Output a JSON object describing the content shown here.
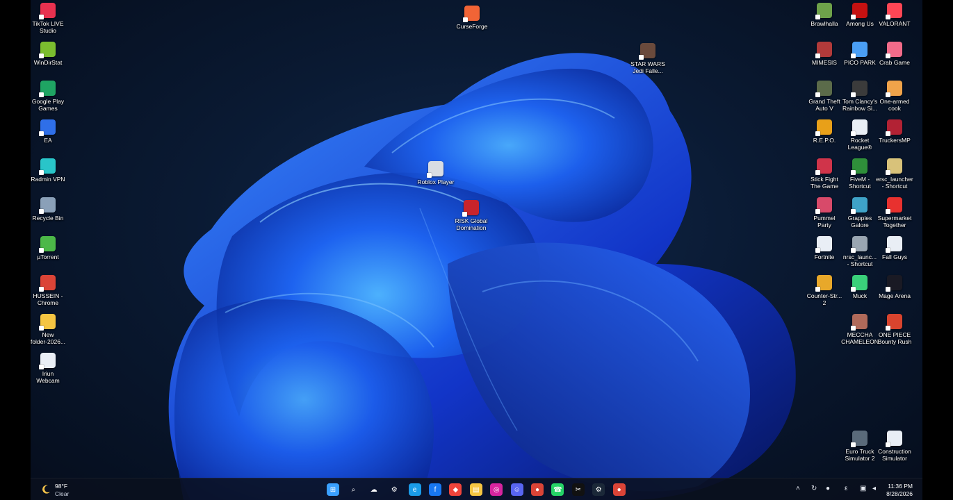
{
  "desktop": {
    "left_column": [
      {
        "name": "TikTok LIVE\nStudio",
        "icon": "tiktok-live-studio-icon",
        "color": "#e8314f"
      },
      {
        "name": "WinDirStat",
        "icon": "windirstat-icon",
        "color": "#7bbd2f"
      },
      {
        "name": "Google Play\nGames",
        "icon": "google-play-games-icon",
        "color": "#1fa463"
      },
      {
        "name": "EA",
        "icon": "ea-icon",
        "color": "#2f6fe8"
      },
      {
        "name": "Radmin VPN",
        "icon": "radmin-vpn-icon",
        "color": "#29c5c9"
      },
      {
        "name": "Recycle Bin",
        "icon": "recycle-bin-icon",
        "color": "#8aa0b8"
      },
      {
        "name": "µTorrent",
        "icon": "utorrent-icon",
        "color": "#4cb848"
      },
      {
        "name": "HUSSEIN -\nChrome",
        "icon": "chrome-icon",
        "color": "#db4437"
      },
      {
        "name": "New\nfolder-2026...",
        "icon": "folder-icon",
        "color": "#f5c542"
      },
      {
        "name": "Iriun\nWebcam",
        "icon": "iriun-webcam-icon",
        "color": "#e9eef5"
      }
    ],
    "top_center": [
      {
        "name": "CurseForge",
        "icon": "curseforge-icon",
        "color": "#f16436"
      },
      {
        "name": "STAR WARS\nJedi Falle...",
        "icon": "star-wars-jedi-icon",
        "color": "#6a4a3c"
      },
      {
        "name": "Roblox Player",
        "icon": "roblox-icon",
        "color": "#d9dde3"
      },
      {
        "name": "RISK Global\nDomination",
        "icon": "risk-icon",
        "color": "#c8242b"
      }
    ],
    "right_grid": [
      {
        "name": "Brawlhalla",
        "icon": "brawlhalla-icon",
        "color": "#6ea24a"
      },
      {
        "name": "Among Us",
        "icon": "among-us-icon",
        "color": "#c51111"
      },
      {
        "name": "VALORANT",
        "icon": "valorant-icon",
        "color": "#ff4655"
      },
      {
        "name": "MIMESIS",
        "icon": "mimesis-icon",
        "color": "#b23a3a"
      },
      {
        "name": "PICO PARK",
        "icon": "pico-park-icon",
        "color": "#4a9ff5"
      },
      {
        "name": "Crab Game",
        "icon": "crab-game-icon",
        "color": "#f26b8a"
      },
      {
        "name": "Grand Theft\nAuto V",
        "icon": "gta-v-icon",
        "color": "#5b6b4a"
      },
      {
        "name": "Tom Clancy's\nRainbow Si...",
        "icon": "rainbow-six-icon",
        "color": "#3b3b3b"
      },
      {
        "name": "One-armed\ncook",
        "icon": "one-armed-cook-icon",
        "color": "#f0a34a"
      },
      {
        "name": "R.E.P.O.",
        "icon": "repo-icon",
        "color": "#e8a019"
      },
      {
        "name": "Rocket\nLeague®",
        "icon": "rocket-league-icon",
        "color": "#e9eef5"
      },
      {
        "name": "TruckersMP",
        "icon": "truckersmp-icon",
        "color": "#b22234"
      },
      {
        "name": "Stick Fight\nThe Game",
        "icon": "stick-fight-icon",
        "color": "#d0344a"
      },
      {
        "name": "FiveM -\nShortcut",
        "icon": "fivem-icon",
        "color": "#2f8f3a"
      },
      {
        "name": "ersc_launcher\n- Shortcut",
        "icon": "ersc-launcher-icon",
        "color": "#d8c27a"
      },
      {
        "name": "Pummel\nParty",
        "icon": "pummel-party-icon",
        "color": "#d84a6a"
      },
      {
        "name": "Grapples\nGalore",
        "icon": "grapples-galore-icon",
        "color": "#3fa3c8"
      },
      {
        "name": "Supermarket\nTogether",
        "icon": "supermarket-together-icon",
        "color": "#e8312f"
      },
      {
        "name": "Fortnite",
        "icon": "fortnite-icon",
        "color": "#e9eef5"
      },
      {
        "name": "nrsc_launc...\n- Shortcut",
        "icon": "nrsc-launcher-icon",
        "color": "#9aa6b2"
      },
      {
        "name": "Fall Guys",
        "icon": "fall-guys-icon",
        "color": "#e9eef5"
      },
      {
        "name": "Counter-Str...\n2",
        "icon": "counter-strike-icon",
        "color": "#e8a82a"
      },
      {
        "name": "Muck",
        "icon": "muck-icon",
        "color": "#3ad07a"
      },
      {
        "name": "Mage Arena",
        "icon": "mage-arena-icon",
        "color": "#1a1a24"
      },
      {
        "name": "MECCHA\nCHAMELEON",
        "icon": "meccha-chameleon-icon",
        "color": "#b06a5a"
      },
      {
        "name": "ONE PIECE\nBounty Rush",
        "icon": "one-piece-icon",
        "color": "#d9442e"
      },
      {
        "name": "Euro Truck\nSimulator 2",
        "icon": "euro-truck-icon",
        "color": "#5a6a7a"
      },
      {
        "name": "Construction\nSimulator",
        "icon": "construction-simulator-icon",
        "color": "#e9eef5"
      }
    ]
  },
  "taskbar": {
    "weather": {
      "temp": "98°F",
      "condition": "Clear",
      "icon": "moon-icon"
    },
    "apps": [
      {
        "icon": "windows-start-icon",
        "color": "#3aa0ff",
        "glyph": "⊞"
      },
      {
        "icon": "search-icon",
        "color": "transparent",
        "glyph": "⌕"
      },
      {
        "icon": "onedrive-icon",
        "color": "transparent",
        "glyph": "☁"
      },
      {
        "icon": "settings-icon",
        "color": "transparent",
        "glyph": "⚙"
      },
      {
        "icon": "edge-icon",
        "color": "#1a9be8",
        "glyph": "e"
      },
      {
        "icon": "facebook-icon",
        "color": "#1877f2",
        "glyph": "f"
      },
      {
        "icon": "anydesk-icon",
        "color": "#ef443b",
        "glyph": "◆"
      },
      {
        "icon": "file-explorer-icon",
        "color": "#f5c542",
        "glyph": "▤"
      },
      {
        "icon": "instagram-icon",
        "color": "#d6249f",
        "glyph": "◎"
      },
      {
        "icon": "discord-icon",
        "color": "#5865f2",
        "glyph": "☺"
      },
      {
        "icon": "chrome-icon",
        "color": "#db4437",
        "glyph": "●"
      },
      {
        "icon": "whatsapp-icon",
        "color": "#25d366",
        "glyph": "☎"
      },
      {
        "icon": "capcut-icon",
        "color": "#111111",
        "glyph": "✂"
      },
      {
        "icon": "steam-icon",
        "color": "#1b2838",
        "glyph": "⚙"
      },
      {
        "icon": "chrome-profile-icon",
        "color": "#db4437",
        "glyph": "●"
      }
    ],
    "tray": [
      {
        "icon": "chevron-up-icon",
        "glyph": "˄"
      },
      {
        "icon": "cloud-sync-icon",
        "glyph": "↻"
      },
      {
        "icon": "microphone-icon",
        "glyph": "●"
      },
      {
        "icon": "language-icon",
        "glyph": "ε"
      },
      {
        "icon": "network-icon",
        "glyph": "▣"
      },
      {
        "icon": "volume-icon",
        "glyph": "◂"
      }
    ],
    "clock": {
      "time": "11:36 PM",
      "date": "8/28/2026"
    }
  }
}
